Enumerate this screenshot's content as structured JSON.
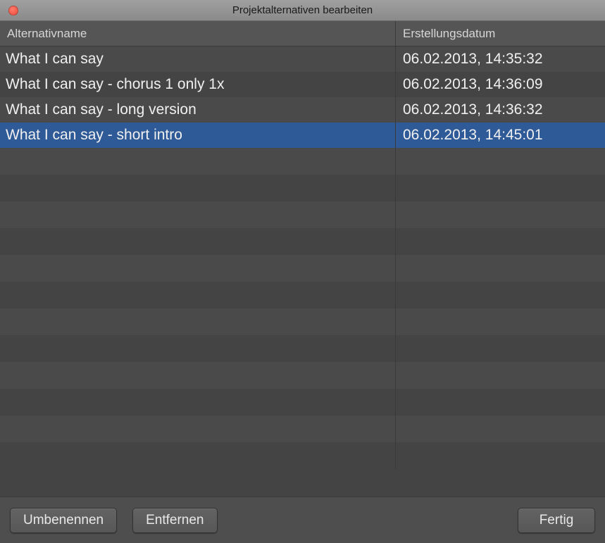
{
  "window": {
    "title": "Projektalternativen bearbeiten"
  },
  "columns": {
    "name": "Alternativname",
    "date": "Erstellungsdatum"
  },
  "rows": [
    {
      "name": "What I can say",
      "date": "06.02.2013, 14:35:32",
      "selected": false
    },
    {
      "name": "What I can say - chorus 1 only 1x",
      "date": "06.02.2013, 14:36:09",
      "selected": false
    },
    {
      "name": "What I can say - long version",
      "date": "06.02.2013, 14:36:32",
      "selected": false
    },
    {
      "name": "What I can say - short intro",
      "date": "06.02.2013, 14:45:01",
      "selected": true
    }
  ],
  "buttons": {
    "rename": "Umbenennen",
    "remove": "Entfernen",
    "done": "Fertig"
  }
}
